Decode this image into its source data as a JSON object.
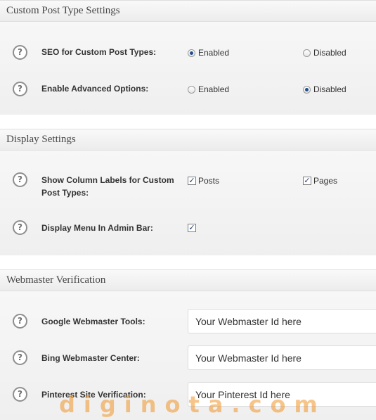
{
  "sections": {
    "custom_post_type": {
      "title": "Custom Post Type Settings",
      "rows": {
        "seo": {
          "help": "?",
          "label": "SEO for Custom Post Types:",
          "options": [
            "Enabled",
            "Disabled"
          ],
          "selected": "Enabled"
        },
        "advanced": {
          "help": "?",
          "label": "Enable Advanced Options:",
          "options": [
            "Enabled",
            "Disabled"
          ],
          "selected": "Disabled"
        }
      }
    },
    "display": {
      "title": "Display Settings",
      "rows": {
        "column_labels": {
          "help": "?",
          "label_line1": "Show Column Labels for Custom",
          "label_line2": "Post Types:",
          "options": [
            "Posts",
            "Pages"
          ],
          "checked": [
            true,
            true
          ]
        },
        "admin_bar": {
          "help": "?",
          "label": "Display Menu In Admin Bar:",
          "checked": true
        }
      }
    },
    "webmaster": {
      "title": "Webmaster Verification",
      "rows": {
        "google": {
          "help": "?",
          "label": "Google Webmaster Tools:",
          "value": "Your Webmaster Id here"
        },
        "bing": {
          "help": "?",
          "label": "Bing Webmaster Center:",
          "value": "Your Webmaster Id here"
        },
        "pinterest": {
          "help": "?",
          "label": "Pinterest Site Verification:",
          "value": "Your Pinterest Id here"
        }
      }
    }
  },
  "watermark": "diginota.com",
  "check_glyph": "✓",
  "colors": {
    "watermark": "#f0962b",
    "selected_radio": "#1f4f8a"
  }
}
